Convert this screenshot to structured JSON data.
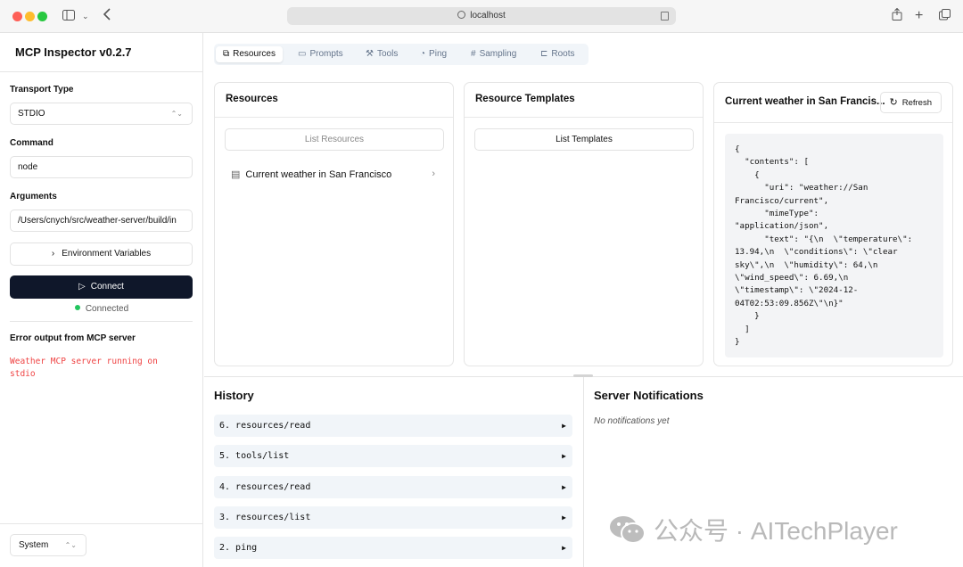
{
  "browser": {
    "url": "localhost"
  },
  "sidebar": {
    "title": "MCP Inspector v0.2.7",
    "transport_label": "Transport Type",
    "transport_value": "STDIO",
    "command_label": "Command",
    "command_value": "node",
    "arguments_label": "Arguments",
    "arguments_value": "/Users/cnych/src/weather-server/build/in",
    "env_button": "Environment Variables",
    "connect_button": "Connect",
    "status": "Connected",
    "error_title": "Error output from MCP server",
    "error_text": "Weather MCP server running on stdio",
    "theme_value": "System"
  },
  "tabs": [
    "Resources",
    "Prompts",
    "Tools",
    "Ping",
    "Sampling",
    "Roots"
  ],
  "resources": {
    "title": "Resources",
    "list_button": "List Resources",
    "items": [
      "Current weather in San Francisco"
    ]
  },
  "templates": {
    "title": "Resource Templates",
    "list_button": "List Templates"
  },
  "detail": {
    "title": "Current weather in San Francis...",
    "refresh_button": "Refresh",
    "json": "{\n  \"contents\": [\n    {\n      \"uri\": \"weather://San\nFrancisco/current\",\n      \"mimeType\":\n\"application/json\",\n      \"text\": \"{\\n  \\\"temperature\\\":\n13.94,\\n  \\\"conditions\\\": \\\"clear\nsky\\\",\\n  \\\"humidity\\\": 64,\\n\n\\\"wind_speed\\\": 6.69,\\n\n\\\"timestamp\\\": \\\"2024-12-\n04T02:53:09.856Z\\\"\\n}\"\n    }\n  ]\n}"
  },
  "history": {
    "title": "History",
    "items": [
      "6. resources/read",
      "5. tools/list",
      "4. resources/read",
      "3. resources/list",
      "2. ping"
    ]
  },
  "notifications": {
    "title": "Server Notifications",
    "empty_text": "No notifications yet"
  },
  "watermark": "公众号 · AITechPlayer"
}
